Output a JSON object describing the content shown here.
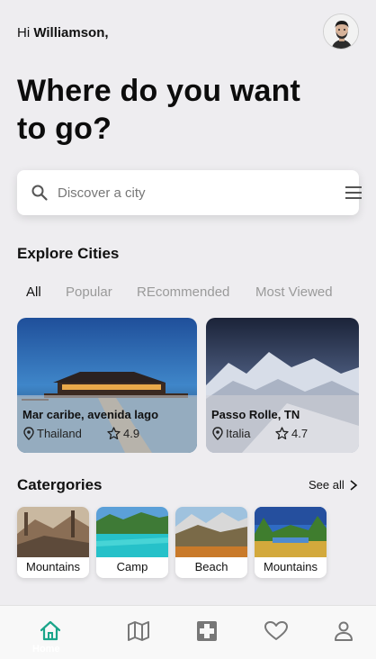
{
  "header": {
    "greeting_prefix": "Hi ",
    "user_name": "Williamson,",
    "headline_line1": "Where do you want",
    "headline_line2": "to go?"
  },
  "search": {
    "placeholder": "Discover a city"
  },
  "explore": {
    "title": "Explore Cities",
    "tabs": [
      "All",
      "Popular",
      "REcommended",
      "Most Viewed"
    ],
    "active_tab": "All",
    "cities": [
      {
        "name": "Mar caribe, avenida lago",
        "location": "Thailand",
        "rating": "4.9"
      },
      {
        "name": "Passo Rolle, TN",
        "location": "Italia",
        "rating": "4.7"
      }
    ]
  },
  "categories": {
    "title": "Catergories",
    "see_all": "See all",
    "items": [
      {
        "label": "Mountains"
      },
      {
        "label": "Camp"
      },
      {
        "label": "Beach"
      },
      {
        "label": "Mountains"
      }
    ]
  },
  "nav": {
    "items": [
      {
        "icon": "home-icon",
        "label": "Home",
        "active": true
      },
      {
        "icon": "map-icon",
        "label": "",
        "active": false
      },
      {
        "icon": "plus-square-icon",
        "label": "",
        "active": false
      },
      {
        "icon": "heart-icon",
        "label": "",
        "active": false
      },
      {
        "icon": "user-icon",
        "label": "",
        "active": false
      }
    ],
    "accent_color": "#1aa58a",
    "inactive_color": "#777777"
  }
}
